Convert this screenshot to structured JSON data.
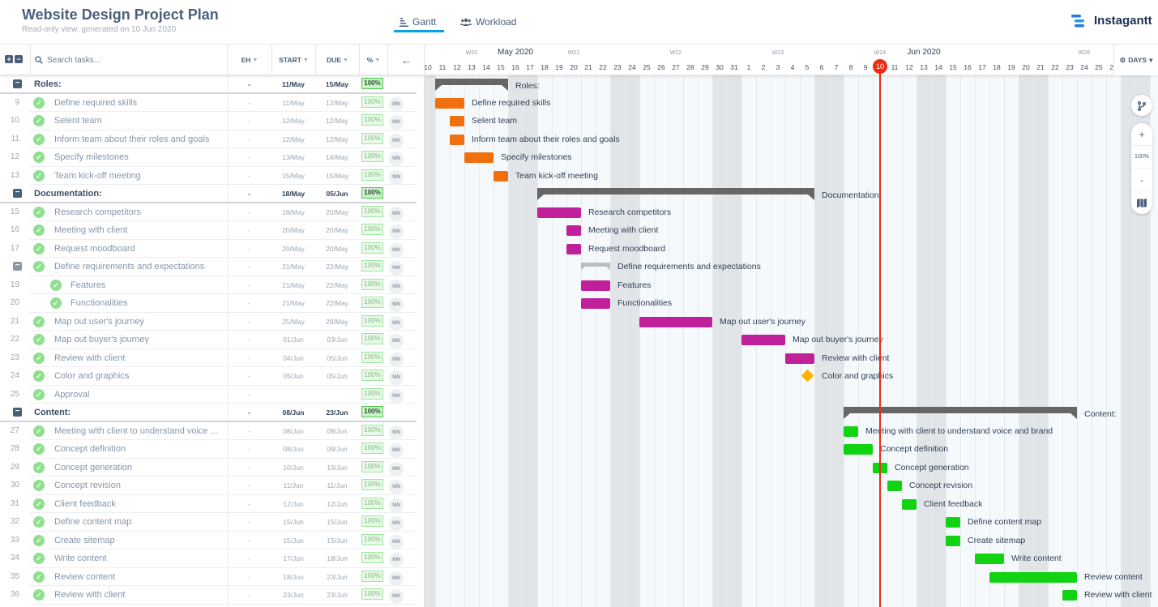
{
  "header": {
    "title": "Website Design Project Plan",
    "subtitle": "Read-only view, generated on 10 Jun 2020",
    "tabs": [
      {
        "label": "Gantt",
        "icon": "gantt-icon",
        "active": true
      },
      {
        "label": "Workload",
        "icon": "users-icon",
        "active": false
      }
    ],
    "logo": "Instagantt"
  },
  "table": {
    "search_placeholder": "Search tasks...",
    "columns": {
      "eh": "EH",
      "start": "START",
      "due": "DUE",
      "pct": "%"
    },
    "collapse_icon": "arrow-left-icon"
  },
  "colors": {
    "orange": "#f07010",
    "magenta": "#c0209a",
    "green": "#11d311",
    "summary": "#666666",
    "milestone": "#ffb300",
    "today": "#ef2b14",
    "accent": "#0aa0e8"
  },
  "timeline": {
    "start_date": "2020-05-10",
    "months": [
      {
        "label": "May 2020",
        "date": "2020-05-16"
      },
      {
        "label": "Jun 2020",
        "date": "2020-06-13"
      }
    ],
    "weeks": [
      {
        "label": "W20",
        "date": "2020-05-13"
      },
      {
        "label": "W21",
        "date": "2020-05-20"
      },
      {
        "label": "W22",
        "date": "2020-05-27"
      },
      {
        "label": "W23",
        "date": "2020-06-03"
      },
      {
        "label": "W24",
        "date": "2020-06-10"
      },
      {
        "label": "W26",
        "date": "2020-06-24"
      }
    ],
    "today": "2020-06-10",
    "today_label": "10",
    "scale": "DAYS",
    "zoom": "100%"
  },
  "rows": [
    {
      "type": "group",
      "name": "Roles:",
      "eh": "-",
      "start": "11/May",
      "due": "15/May",
      "pct": "100%",
      "bar": {
        "from": "2020-05-11",
        "to": "2020-05-15"
      }
    },
    {
      "type": "task",
      "num": "9",
      "name": "Define required skills",
      "eh": "-",
      "start": "11/May",
      "due": "12/May",
      "pct": "100%",
      "avatar": "NN",
      "bar": {
        "from": "2020-05-11",
        "to": "2020-05-12",
        "color": "orange"
      }
    },
    {
      "type": "task",
      "num": "10",
      "name": "Selent team",
      "eh": "-",
      "start": "12/May",
      "due": "12/May",
      "pct": "100%",
      "avatar": "NN",
      "bar": {
        "from": "2020-05-12",
        "to": "2020-05-12",
        "color": "orange"
      }
    },
    {
      "type": "task",
      "num": "11",
      "name": "Inform team about their roles and goals",
      "eh": "-",
      "start": "12/May",
      "due": "12/May",
      "pct": "100%",
      "avatar": "NN",
      "bar": {
        "from": "2020-05-12",
        "to": "2020-05-12",
        "color": "orange"
      }
    },
    {
      "type": "task",
      "num": "12",
      "name": "Specify milestones",
      "eh": "-",
      "start": "13/May",
      "due": "14/May",
      "pct": "100%",
      "avatar": "NN",
      "bar": {
        "from": "2020-05-13",
        "to": "2020-05-14",
        "color": "orange"
      }
    },
    {
      "type": "task",
      "num": "13",
      "name": "Team kick-off meeting",
      "eh": "-",
      "start": "15/May",
      "due": "15/May",
      "pct": "100%",
      "avatar": "NN",
      "bar": {
        "from": "2020-05-15",
        "to": "2020-05-15",
        "color": "orange"
      }
    },
    {
      "type": "group",
      "name": "Documentation:",
      "eh": "-",
      "start": "18/May",
      "due": "05/Jun",
      "pct": "100%",
      "bar": {
        "from": "2020-05-18",
        "to": "2020-06-05"
      }
    },
    {
      "type": "task",
      "num": "15",
      "name": "Research competitors",
      "eh": "-",
      "start": "18/May",
      "due": "20/May",
      "pct": "100%",
      "avatar": "NN",
      "bar": {
        "from": "2020-05-18",
        "to": "2020-05-20",
        "color": "magenta"
      }
    },
    {
      "type": "task",
      "num": "16",
      "name": "Meeting with client",
      "eh": "-",
      "start": "20/May",
      "due": "20/May",
      "pct": "100%",
      "avatar": "NN",
      "bar": {
        "from": "2020-05-20",
        "to": "2020-05-20",
        "color": "magenta"
      }
    },
    {
      "type": "task",
      "num": "17",
      "name": "Request moodboard",
      "eh": "-",
      "start": "20/May",
      "due": "20/May",
      "pct": "100%",
      "avatar": "NN",
      "bar": {
        "from": "2020-05-20",
        "to": "2020-05-20",
        "color": "magenta"
      }
    },
    {
      "type": "subgroup",
      "name": "Define requirements and expectations",
      "eh": "-",
      "start": "21/May",
      "due": "22/May",
      "pct": "100%",
      "avatar": "NN",
      "bar": {
        "from": "2020-05-21",
        "to": "2020-05-22"
      }
    },
    {
      "type": "subtask",
      "num": "19",
      "name": "Features",
      "eh": "-",
      "start": "21/May",
      "due": "22/May",
      "pct": "100%",
      "avatar": "NN",
      "bar": {
        "from": "2020-05-21",
        "to": "2020-05-22",
        "color": "magenta"
      }
    },
    {
      "type": "subtask",
      "num": "20",
      "name": "Functionalities",
      "eh": "-",
      "start": "21/May",
      "due": "22/May",
      "pct": "100%",
      "avatar": "NN",
      "bar": {
        "from": "2020-05-21",
        "to": "2020-05-22",
        "color": "magenta"
      }
    },
    {
      "type": "task",
      "num": "21",
      "name": "Map out user's journey",
      "eh": "-",
      "start": "25/May",
      "due": "29/May",
      "pct": "100%",
      "avatar": "NN",
      "bar": {
        "from": "2020-05-25",
        "to": "2020-05-29",
        "color": "magenta"
      }
    },
    {
      "type": "task",
      "num": "22",
      "name": "Map out buyer's journey",
      "eh": "-",
      "start": "01/Jun",
      "due": "03/Jun",
      "pct": "100%",
      "avatar": "NN",
      "bar": {
        "from": "2020-06-01",
        "to": "2020-06-03",
        "color": "magenta"
      }
    },
    {
      "type": "task",
      "num": "23",
      "name": "Review with client",
      "eh": "-",
      "start": "04/Jun",
      "due": "05/Jun",
      "pct": "100%",
      "avatar": "NN",
      "bar": {
        "from": "2020-06-04",
        "to": "2020-06-05",
        "color": "magenta"
      }
    },
    {
      "type": "task",
      "num": "24",
      "name": "Color and graphics",
      "eh": "-",
      "start": "05/Jun",
      "due": "05/Jun",
      "pct": "100%",
      "avatar": "NN",
      "bar": {
        "from": "2020-06-05",
        "to": "2020-06-05",
        "milestone": true
      }
    },
    {
      "type": "task",
      "num": "25",
      "name": "Approval",
      "eh": "-",
      "start": "",
      "due": "",
      "pct": "100%",
      "avatar": "NN"
    },
    {
      "type": "group",
      "name": "Content:",
      "eh": "-",
      "start": "08/Jun",
      "due": "23/Jun",
      "pct": "100%",
      "bar": {
        "from": "2020-06-08",
        "to": "2020-06-23"
      }
    },
    {
      "type": "task",
      "num": "27",
      "name": "Meeting with client to understand voice ...",
      "label": "Meeting with client to understand voice and brand",
      "eh": "-",
      "start": "08/Jun",
      "due": "08/Jun",
      "pct": "100%",
      "avatar": "NN",
      "bar": {
        "from": "2020-06-08",
        "to": "2020-06-08",
        "color": "green"
      }
    },
    {
      "type": "task",
      "num": "28",
      "name": "Concept definition",
      "eh": "-",
      "start": "08/Jun",
      "due": "09/Jun",
      "pct": "100%",
      "avatar": "NN",
      "bar": {
        "from": "2020-06-08",
        "to": "2020-06-09",
        "color": "green"
      }
    },
    {
      "type": "task",
      "num": "29",
      "name": "Concept generation",
      "eh": "-",
      "start": "10/Jun",
      "due": "10/Jun",
      "pct": "100%",
      "avatar": "NN",
      "bar": {
        "from": "2020-06-10",
        "to": "2020-06-10",
        "color": "green"
      }
    },
    {
      "type": "task",
      "num": "30",
      "name": "Concept revision",
      "eh": "-",
      "start": "11/Jun",
      "due": "11/Jun",
      "pct": "100%",
      "avatar": "NN",
      "bar": {
        "from": "2020-06-11",
        "to": "2020-06-11",
        "color": "green"
      }
    },
    {
      "type": "task",
      "num": "31",
      "name": "Client feedback",
      "eh": "-",
      "start": "12/Jun",
      "due": "12/Jun",
      "pct": "100%",
      "avatar": "NN",
      "bar": {
        "from": "2020-06-12",
        "to": "2020-06-12",
        "color": "green"
      }
    },
    {
      "type": "task",
      "num": "32",
      "name": "Define content map",
      "eh": "-",
      "start": "15/Jun",
      "due": "15/Jun",
      "pct": "100%",
      "avatar": "NN",
      "bar": {
        "from": "2020-06-15",
        "to": "2020-06-15",
        "color": "green"
      }
    },
    {
      "type": "task",
      "num": "33",
      "name": "Create sitemap",
      "eh": "-",
      "start": "15/Jun",
      "due": "15/Jun",
      "pct": "100%",
      "avatar": "NN",
      "bar": {
        "from": "2020-06-15",
        "to": "2020-06-15",
        "color": "green"
      }
    },
    {
      "type": "task",
      "num": "34",
      "name": "Write content",
      "eh": "-",
      "start": "17/Jun",
      "due": "18/Jun",
      "pct": "100%",
      "avatar": "NN",
      "bar": {
        "from": "2020-06-17",
        "to": "2020-06-18",
        "color": "green"
      }
    },
    {
      "type": "task",
      "num": "35",
      "name": "Review content",
      "eh": "-",
      "start": "18/Jun",
      "due": "23/Jun",
      "pct": "100%",
      "avatar": "NN",
      "bar": {
        "from": "2020-06-18",
        "to": "2020-06-23",
        "color": "green"
      }
    },
    {
      "type": "task",
      "num": "36",
      "name": "Review with client",
      "eh": "-",
      "start": "23/Jun",
      "due": "23/Jun",
      "pct": "100%",
      "avatar": "NN",
      "bar": {
        "from": "2020-06-23",
        "to": "2020-06-23",
        "color": "green"
      }
    }
  ]
}
